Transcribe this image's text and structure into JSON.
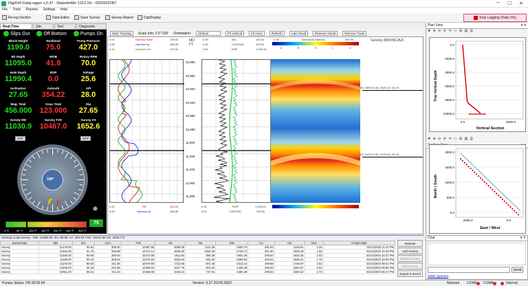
{
  "window": {
    "title": "DigiDrill DataLogger v.5.37 - DiabelisWin 1313 2H - DDD5022B7"
  },
  "menu": [
    "File",
    "Tools",
    "Reports",
    "Settings",
    "Help"
  ],
  "toolbar": {
    "relog": "Re-log Section",
    "editor": "Data Editor",
    "save": "Save Survey",
    "report": "Survey Report",
    "display": "DigiDisplay",
    "stop": "Stop Logging (Daily 5%)"
  },
  "tabs": [
    "Real-Time Display",
    "Job Center",
    "Tool Center",
    "Diagnostic Center"
  ],
  "status_indicators": [
    {
      "label": "Slips Out",
      "color": "#22cc22"
    },
    {
      "label": "Off Bottom",
      "color": "#22cc22"
    },
    {
      "label": "Pumps On",
      "color": "#22cc22"
    }
  ],
  "readouts": [
    {
      "label": "Block Height",
      "value": "1199.0",
      "color": "gr"
    },
    {
      "label": "Hookload",
      "value": "75.0",
      "color": "rd"
    },
    {
      "label": "Pump Pressure",
      "value": "427.0",
      "color": "yl"
    },
    {
      "label": "Bit Depth",
      "value": "11095.0",
      "color": "gr"
    },
    {
      "label": "WOB",
      "value": "41.8",
      "color": "rd"
    },
    {
      "label": "Rotary RPM",
      "value": "70.0",
      "color": "yl"
    },
    {
      "label": "Hole Depth",
      "value": "11990.4",
      "color": "gr"
    },
    {
      "label": "ROP",
      "value": "0.0",
      "color": "rd"
    },
    {
      "label": "Voltage",
      "value": "25.6",
      "color": "yl"
    },
    {
      "label": "Inclination",
      "value": "27.65",
      "color": "gr"
    },
    {
      "label": "Azimuth",
      "value": "354.22",
      "color": "rd"
    },
    {
      "label": "API",
      "value": "28.0",
      "color": "yl"
    },
    {
      "label": "Mag. Total",
      "value": "456.000",
      "color": "gr"
    },
    {
      "label": "Grav. Total",
      "value": "123.000",
      "color": "rd"
    },
    {
      "label": "Dip",
      "value": "27.65",
      "color": "yl"
    },
    {
      "label": "Survey MD",
      "value": "11030.9",
      "color": "gr"
    },
    {
      "label": "Survey TVD",
      "value": "10467.0",
      "color": "rd"
    },
    {
      "label": "Survey VS",
      "value": "1652.6",
      "color": "yl"
    }
  ],
  "gauge": {
    "toolface": "168°",
    "gtf": "GTF",
    "mtf": "MTF"
  },
  "temperature": {
    "ticks": [
      "0 °F",
      "50 °F",
      "100 °F",
      "150 °F",
      "200 °F",
      "250 °F",
      "300 °F"
    ],
    "value": "75"
  },
  "tracking": {
    "start": "Start Tracking",
    "scale": "Scale Info: 2.5\":100'",
    "orientation_label": "Orientation:",
    "orientation": "Vertical",
    "fit_vertical": "Fit Vertical",
    "fit_horiz": "Fit Horiz",
    "refresh": "Refresh",
    "add_visual": "Add Visual",
    "remove_visual": "Remove Visual",
    "remove_track": "Remove Track"
  },
  "log_headers": {
    "t1": [
      {
        "l": "0.00",
        "n": "Gamma Down",
        "r": "150.00",
        "c": "red"
      },
      {
        "l": "0.00",
        "n": "Gamma Up",
        "r": "150.00",
        "c": "blu"
      },
      {
        "l": "0.00",
        "n": "Gamma Left",
        "r": "150.00",
        "c": "grn"
      }
    ],
    "md": "MD",
    "ft": "FT",
    "t2": [
      {
        "l": "0.00",
        "n": "INC",
        "r": "100.00"
      },
      {
        "l": "0.00",
        "n": "CONTINC",
        "r": "100.00"
      },
      {
        "l": "0.00",
        "n": "ROP",
        "r": "1,000.00"
      }
    ],
    "az_title": "Azimuthal Gamma",
    "az_min": "0.00",
    "az_max": "300.00",
    "az_labels": [
      "U",
      "R",
      "D",
      "L",
      "U"
    ],
    "surveys": "Surveys (MD/INC/AZ)",
    "survey_marks": [
      "MD: 10890.00 INC: 88.51 AZ: 311.44",
      "MD: 11000.00 INC: 89.26 AZ: 312.44"
    ],
    "depths": [
      "10,880",
      "10,900",
      "10,920",
      "10,940",
      "10,960",
      "10,980",
      "11,000",
      "11,020",
      "11,040",
      "11,060",
      "11,080"
    ],
    "foot1": "GR",
    "foot2": "Gamma Up",
    "foot3": "ROP",
    "foot4": "CONTINC"
  },
  "plan_view": {
    "title": "Plan View",
    "ylabel": "True Vertical Depth",
    "xlabel": "Vertical Section",
    "yticks": [
      "0.0",
      "2000.0",
      "4000.0",
      "6000.0",
      "8000.0",
      "10000.0"
    ],
    "xticks": [
      "0.0",
      "5000.0"
    ]
  },
  "section_view": {
    "title": "Section View",
    "ylabel": "North / South",
    "xlabel": "East / West",
    "yticks": [
      "2000.0",
      "1500.0",
      "1000.0",
      "500.0",
      "0.0"
    ],
    "xticks": [
      "-2000.0",
      "0.0"
    ]
  },
  "survey_table": {
    "caption": "Surveys (Last survey - MD: 12468.00, Inc: 88.88, Az: 306.20 TVD: 10410.36 VS: 3105.77)",
    "columns": [
      "SurveyType",
      "MD",
      "Incl.",
      "Azm.",
      "TVD",
      "VS",
      "NS",
      "EW",
      "CA",
      "CD",
      "DLS",
      "Create Date"
    ],
    "rows": [
      [
        "Survey",
        "11476.00",
        "92.81",
        "309.40",
        "10467.56",
        "2089.46",
        "1111.36",
        "-1883.70",
        "301.64",
        "2118.81",
        "1.26",
        "02/13/2020 11:24 PM"
      ],
      [
        "Survey",
        "11384.00",
        "91.76",
        "308.98",
        "10471.14",
        "2005.62",
        "1052.28",
        "-1730.71",
        "301.30",
        "2026.49",
        "1.85",
        "02/13/2020 10:48 PM"
      ],
      [
        "Survey",
        "11292.00",
        "90.06",
        "309.03",
        "10473.00",
        "1911.84",
        "993.39",
        "-1661.46",
        "300.84",
        "1932.25",
        "1.03",
        "02/13/2020 10:27 PM"
      ],
      [
        "Survey",
        "11198.00",
        "89.24",
        "309.51",
        "10473.02",
        "1816.54",
        "933.26",
        "-1589.82",
        "300.51",
        "1838.41",
        "1.75",
        "02/13/2020 10:05 PM"
      ],
      [
        "Survey",
        "11103.00",
        "88.63",
        "311.06",
        "10470.69",
        "1722.56",
        "872.46",
        "-1512.24",
        "299.88",
        "1746.87",
        "2.52",
        "02/13/2020 09:41 PM"
      ],
      [
        "Survey",
        "11009.00",
        "86.26",
        "310.55",
        "10468.93",
        "1627.70",
        "810.20",
        "-1448.49",
        "299.35",
        "1652.87",
        "0.53",
        "02/13/2020 08:58 PM"
      ],
      [
        "Survey",
        "10911.00",
        "85.51",
        "311.44",
        "10458.05",
        "1533.13",
        "747.91",
        "-1359.48",
        "298.84",
        "1560.32",
        "3.72",
        "02/13/2020 08:27 PM"
      ]
    ]
  },
  "survey_buttons": [
    "Refresh",
    "Add Survey",
    "Delete Survey",
    "Edit Survey",
    "Export to Excel"
  ],
  "chat": {
    "title": "Chat",
    "send": "Send",
    "operator": "MWD Operator"
  },
  "statusbar": {
    "pumps": "Pumps Status: ON   00:05:04",
    "version": "Version: 5.37.20145.5002",
    "network": "Network",
    "com1": "COM5",
    "com2": "COM8",
    "internal": "Internal"
  }
}
